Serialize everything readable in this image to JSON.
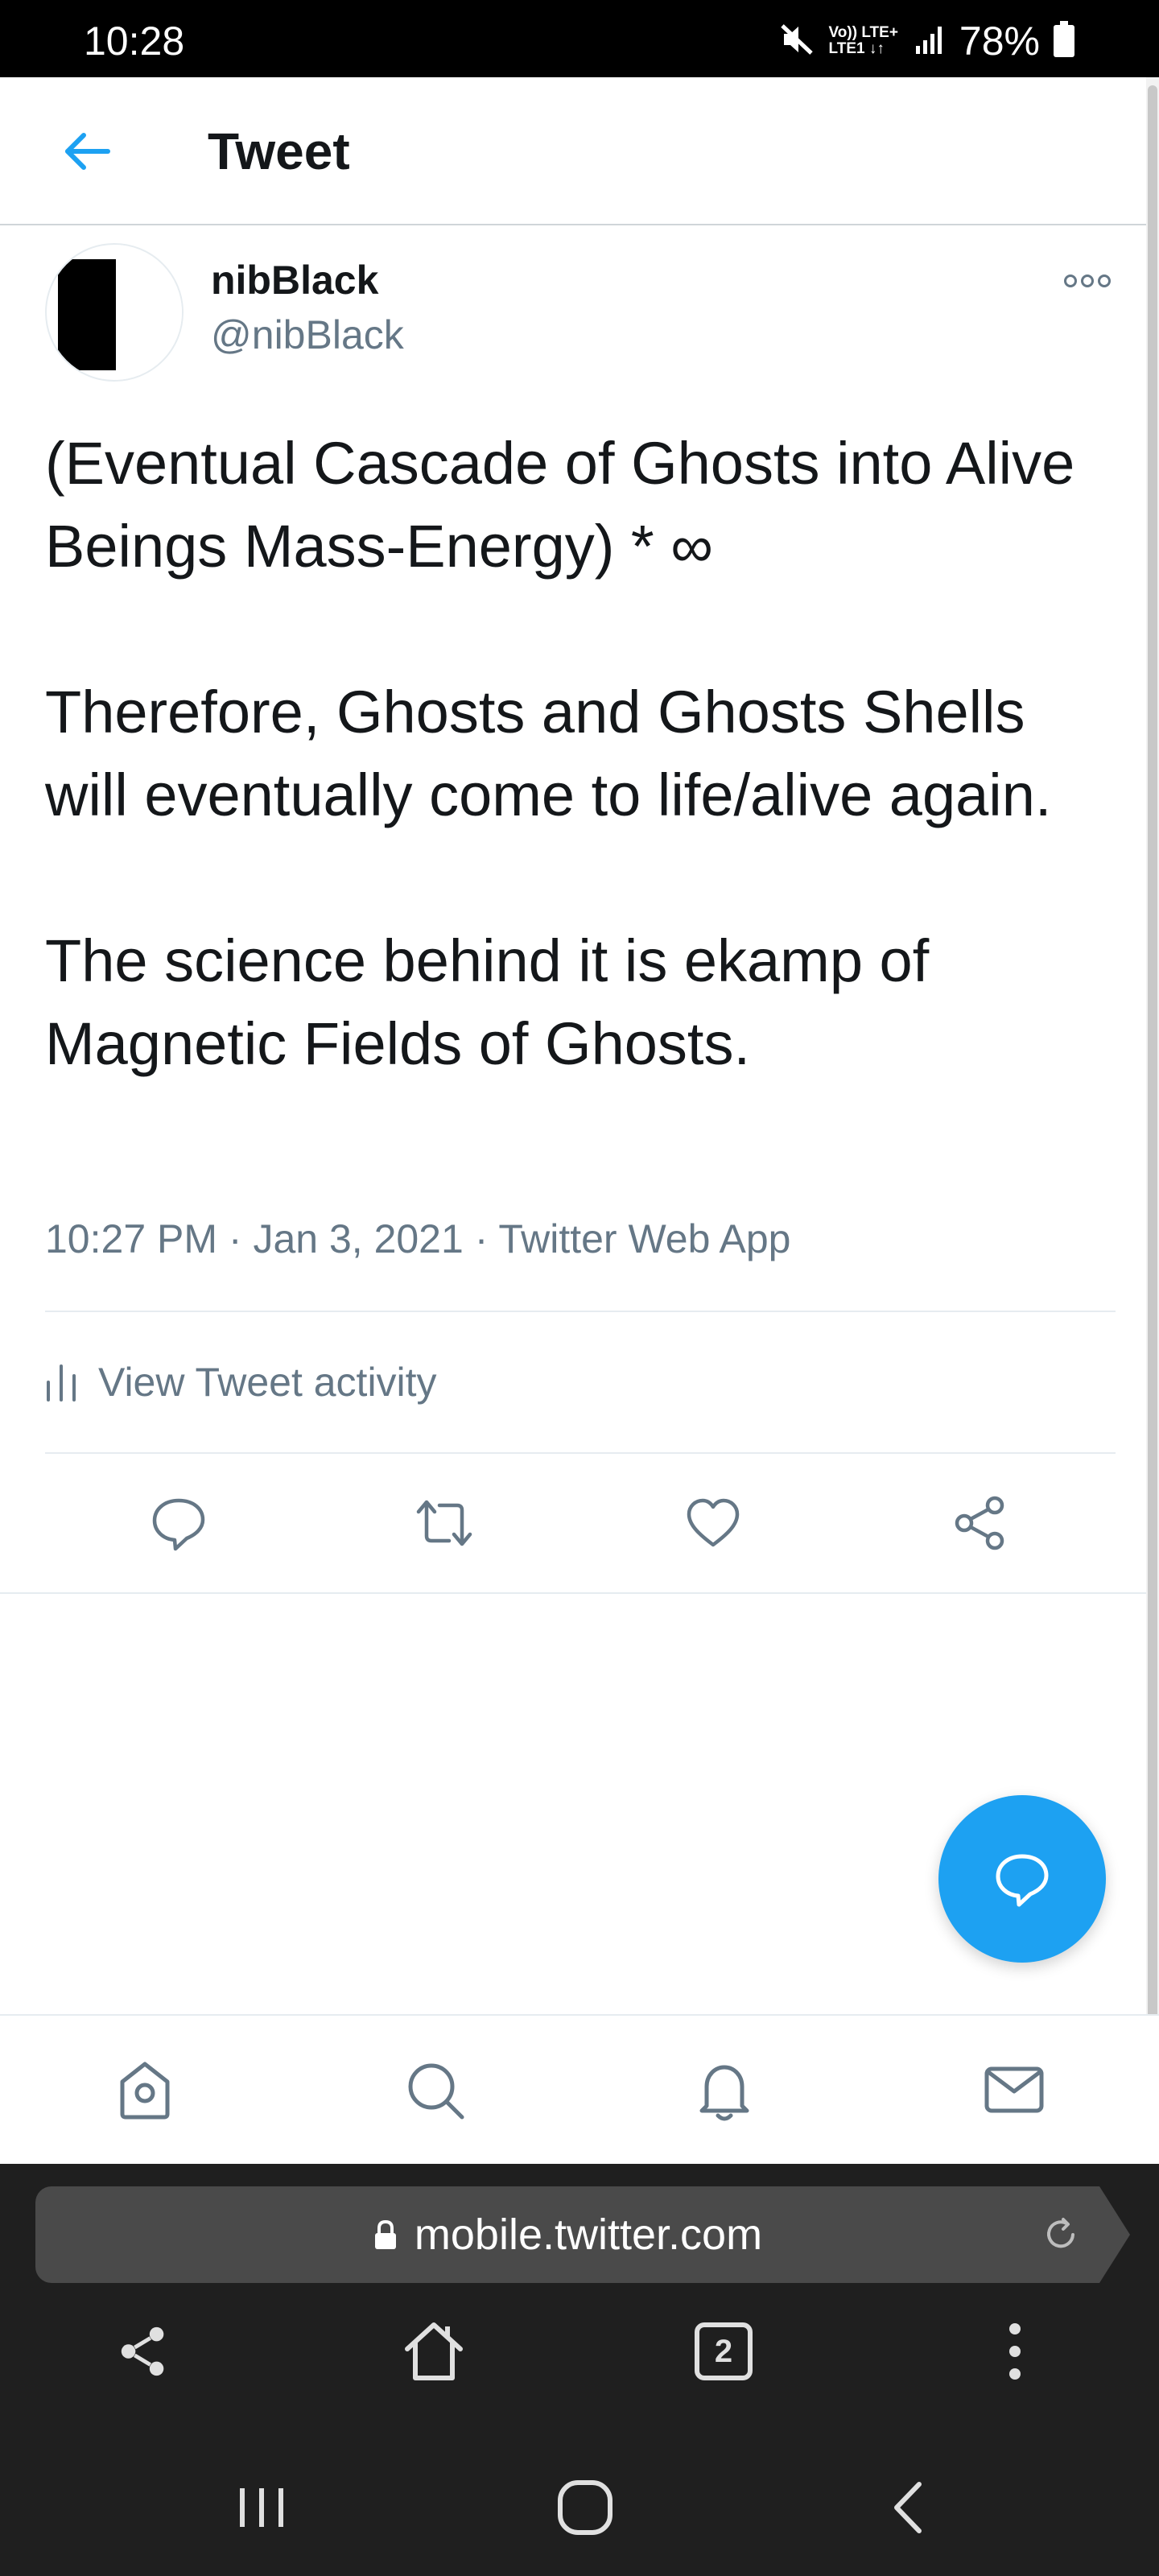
{
  "status_bar": {
    "time": "10:28",
    "battery_percent": "78%",
    "network_top": "Vo)) LTE+",
    "network_bottom": "LTE1 ↓↑"
  },
  "header": {
    "title": "Tweet"
  },
  "tweet": {
    "display_name": "nibBlack",
    "handle": "@nibBlack",
    "paragraphs": [
      "(Eventual Cascade of Ghosts into Alive Beings Mass-Energy) * ∞",
      "Therefore, Ghosts and Ghosts Shells will eventually come to life/alive again.",
      "The science behind it is ekamp of Magnetic Fields of Ghosts."
    ],
    "time": "10:27 PM",
    "date": "Jan 3, 2021",
    "source": "Twitter Web App",
    "activity_label": "View Tweet activity"
  },
  "browser": {
    "url": "mobile.twitter.com",
    "tab_count": "2"
  },
  "colors": {
    "accent": "#1da1f2",
    "text_primary": "#14171a",
    "text_secondary": "#657786",
    "browser_bg": "#1f1f1f"
  }
}
